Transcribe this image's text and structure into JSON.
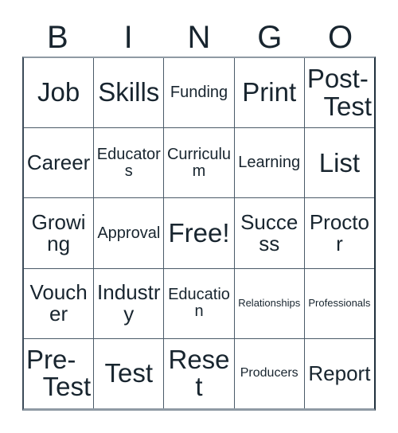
{
  "card": {
    "title": "Bingo Card",
    "header_letters": [
      "B",
      "I",
      "N",
      "G",
      "O"
    ],
    "columns": 5,
    "rows": 5,
    "colors": {
      "text": "#18252f",
      "grid_line": "#4a5a68",
      "outer_border": "#8f9aa4",
      "background": "#ffffff"
    },
    "grid": [
      [
        {
          "label": "Job",
          "size": "xxl",
          "wrap": false
        },
        {
          "label": "Skills",
          "size": "xxl",
          "wrap": false
        },
        {
          "label": "Funding",
          "size": "l",
          "wrap": false
        },
        {
          "label": "Print",
          "size": "xxl",
          "wrap": false
        },
        {
          "label": "Post-Test",
          "size": "xxl",
          "wrap": true,
          "line1": "Post-",
          "line2": "Test"
        }
      ],
      [
        {
          "label": "Career",
          "size": "xl",
          "wrap": false
        },
        {
          "label": "Educators",
          "size": "l",
          "wrap": false
        },
        {
          "label": "Curriculum",
          "size": "l",
          "wrap": false
        },
        {
          "label": "Learning",
          "size": "l",
          "wrap": false
        },
        {
          "label": "List",
          "size": "xxl",
          "wrap": false
        }
      ],
      [
        {
          "label": "Growing",
          "size": "xl",
          "wrap": false
        },
        {
          "label": "Approval",
          "size": "l",
          "wrap": false
        },
        {
          "label": "Free!",
          "size": "xxl",
          "wrap": false
        },
        {
          "label": "Success",
          "size": "xl",
          "wrap": false
        },
        {
          "label": "Proctor",
          "size": "xl",
          "wrap": false
        }
      ],
      [
        {
          "label": "Voucher",
          "size": "xl",
          "wrap": false
        },
        {
          "label": "Industry",
          "size": "xl",
          "wrap": false
        },
        {
          "label": "Education",
          "size": "l",
          "wrap": false
        },
        {
          "label": "Relationships",
          "size": "s",
          "wrap": false
        },
        {
          "label": "Professionals",
          "size": "s",
          "wrap": false
        }
      ],
      [
        {
          "label": "Pre-Test",
          "size": "xxl",
          "wrap": true,
          "line1": "Pre-",
          "line2": "Test"
        },
        {
          "label": "Test",
          "size": "xxl",
          "wrap": false
        },
        {
          "label": "Reset",
          "size": "xxl",
          "wrap": false
        },
        {
          "label": "Producers",
          "size": "m",
          "wrap": false
        },
        {
          "label": "Report",
          "size": "xl",
          "wrap": false
        }
      ]
    ],
    "free_space": {
      "row": 2,
      "column": 2,
      "label": "Free!"
    }
  }
}
